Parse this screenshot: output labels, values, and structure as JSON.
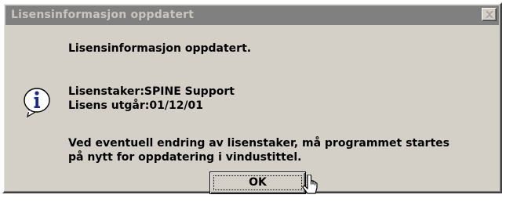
{
  "window": {
    "title": "Lisensinformasjon oppdatert"
  },
  "message": {
    "line1": "Lisensinformasjon oppdatert.",
    "line2": "Lisenstaker:SPINE Support",
    "line3": "Lisens utgår:01/12/01",
    "line4": "Ved eventuell endring av lisenstaker, må programmet startes",
    "line5": "på nytt for oppdatering i vindustittel."
  },
  "buttons": {
    "ok_label": "OK"
  },
  "icons": {
    "info": "information-icon",
    "close": "close-icon",
    "cursor": "mouse-cursor-icon"
  },
  "colors": {
    "dialog_bg": "#d4d0c8",
    "titlebar_inactive": "#808080",
    "title_text": "#c9c6bf",
    "info_icon_blue": "#1a2a9a"
  }
}
